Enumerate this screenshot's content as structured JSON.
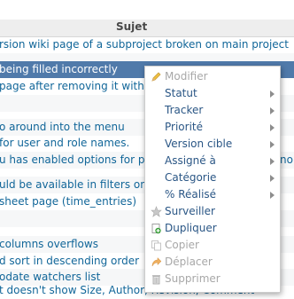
{
  "table": {
    "header": "Sujet",
    "rows": [
      "rsion wiki page of a subproject broken on main project",
      "",
      "being filled incorrectly",
      " page after removing it without",
      "",
      "",
      "o around into the menu",
      " for user and role names.",
      "u has enabled options for pa",
      "",
      "uld be available in filters only",
      "sheet page (time_entries)",
      "",
      "",
      "columns overflows",
      "d sort in descending order",
      "odate watchers list",
      "t doesn't show Size, Author, Revision, Comment"
    ]
  },
  "row_tail_text": "no v",
  "context_menu": {
    "items": [
      {
        "label": "Modifier",
        "icon": "pencil-icon"
      },
      {
        "label": "Statut"
      },
      {
        "label": "Tracker"
      },
      {
        "label": "Priorité"
      },
      {
        "label": "Version cible"
      },
      {
        "label": "Assigné à"
      },
      {
        "label": "Catégorie"
      },
      {
        "label": "% Réalisé"
      },
      {
        "label": "Surveiller",
        "icon": "star-icon"
      },
      {
        "label": "Dupliquer",
        "icon": "duplicate-icon"
      },
      {
        "label": "Copier",
        "icon": "copy-icon"
      },
      {
        "label": "Déplacer",
        "icon": "move-icon"
      },
      {
        "label": "Supprimer",
        "icon": "trash-icon"
      }
    ]
  },
  "colors": {
    "selected_row": "#507aaa",
    "link": "#116699",
    "menu_text": "#2a5685",
    "disabled_text": "#a8a8a8"
  }
}
